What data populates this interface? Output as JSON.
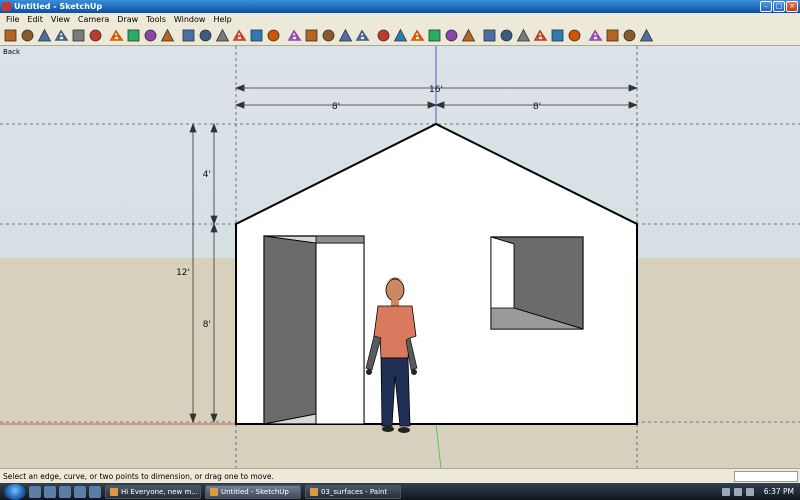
{
  "window": {
    "title": "Untitled - SketchUp"
  },
  "menu": [
    "File",
    "Edit",
    "View",
    "Camera",
    "Draw",
    "Tools",
    "Window",
    "Help"
  ],
  "toolbar": {
    "tools": [
      "house-icon",
      "door-icon",
      "home-icon",
      "save-icon",
      "house-outline-icon",
      "paint-icon",
      "sep",
      "select-icon",
      "eraser-icon",
      "paint-bucket-icon",
      "erase-tool-icon",
      "sep",
      "rectangle-icon",
      "line-icon",
      "circle-icon",
      "arc-icon",
      "polygon-icon",
      "freehand-icon",
      "sep",
      "move-icon",
      "push-pull-icon",
      "rotate-icon",
      "follow-me-icon",
      "scale-icon",
      "sep",
      "tape-measure-icon",
      "dimension-icon",
      "protractor-icon",
      "text-icon",
      "axes-icon",
      "3d-text-icon",
      "sep",
      "orbit-icon",
      "pan-icon",
      "zoom-icon",
      "zoom-window-icon",
      "zoom-extents-icon",
      "previous-icon",
      "sep",
      "position-camera-icon",
      "look-around-icon",
      "walk-icon",
      "section-plane-icon"
    ]
  },
  "viewport": {
    "scene_label": "Back",
    "dimensions": {
      "total_width": "16'",
      "left_half": "8'",
      "right_half": "8'",
      "roof_height": "4'",
      "total_height": "12'",
      "wall_height": "8'"
    },
    "colors": {
      "sky": "#d8e1e6",
      "ground": "#d6d0bd",
      "wall": "#ffffff",
      "opening": "#6b6b6b",
      "axis_red": "#c0392b",
      "axis_green": "#2ecc40",
      "axis_blue": "#1f3fbf"
    }
  },
  "status": {
    "text": "Select an edge, curve, or two points to dimension, or drag one to move."
  },
  "taskbar": {
    "buttons": [
      {
        "label": "Hi Everyone, new m...",
        "active": false
      },
      {
        "label": "Untitled - SketchUp",
        "active": true
      },
      {
        "label": "03_surfaces - Paint",
        "active": false
      }
    ],
    "clock": "6:37 PM"
  }
}
